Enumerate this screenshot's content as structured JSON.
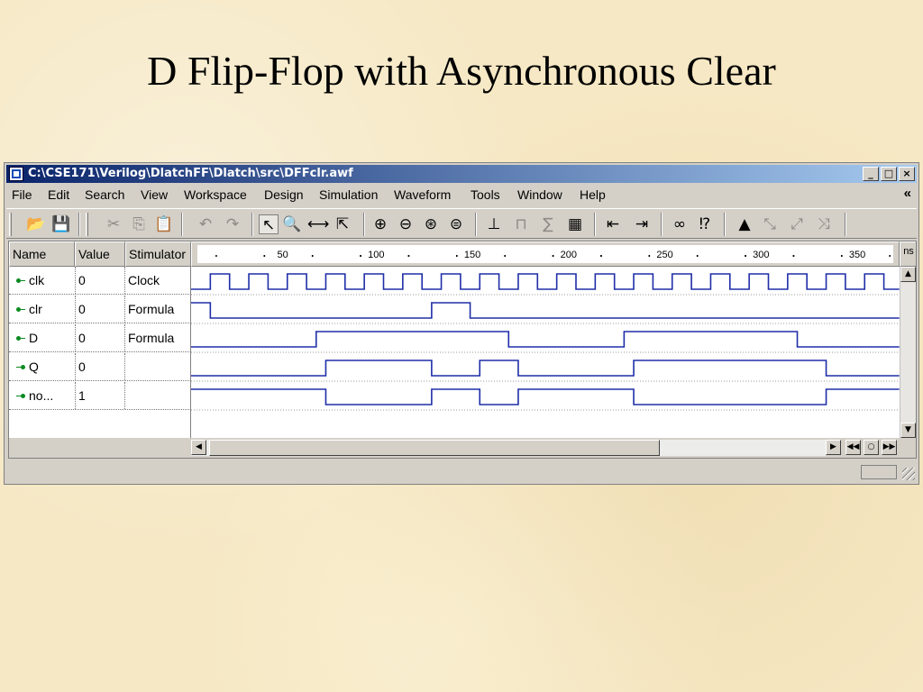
{
  "slide": {
    "title": "D Flip-Flop with Asynchronous Clear"
  },
  "window": {
    "title": "C:\\CSE171\\Verilog\\DlatchFF\\Dlatch\\src\\DFFclr.awf",
    "controls": {
      "minimize": "_",
      "maximize": "□",
      "close": "×"
    }
  },
  "menu": {
    "items": [
      "File",
      "Edit",
      "Search",
      "View",
      "Workspace",
      "Design",
      "Simulation",
      "Waveform",
      "Tools",
      "Window",
      "Help"
    ],
    "overflow": "«"
  },
  "toolbar": {
    "icons": [
      "open-folder",
      "save",
      "cut",
      "copy",
      "paste",
      "undo",
      "redo",
      "select-pointer",
      "zoom",
      "measure",
      "edit-pointer",
      "zoom-in",
      "zoom-out",
      "zoom-fit",
      "zoom-area",
      "add-signal",
      "clock-signal",
      "formula",
      "stimulators",
      "goto-start",
      "goto-end",
      "find",
      "find-next",
      "marker",
      "edge-prev",
      "edge-next",
      "edge-any"
    ]
  },
  "columns": {
    "name": "Name",
    "value": "Value",
    "stimulator": "Stimulator"
  },
  "timeline": {
    "unit": "ns",
    "labels": [
      "50",
      "100",
      "150",
      "200",
      "250",
      "300",
      "350"
    ]
  },
  "signals": [
    {
      "name": "clk",
      "value": "0",
      "stimulator": "Clock",
      "direction": "input"
    },
    {
      "name": "clr",
      "value": "0",
      "stimulator": "Formula",
      "direction": "input"
    },
    {
      "name": "D",
      "value": "0",
      "stimulator": "Formula",
      "direction": "input"
    },
    {
      "name": "Q",
      "value": "0",
      "stimulator": "",
      "direction": "output"
    },
    {
      "name": "no...",
      "value": "1",
      "stimulator": "",
      "direction": "output"
    }
  ],
  "colors": {
    "wave": "#1f2ea8",
    "title_bar": "#0a246a",
    "pin": "#0a8a20"
  }
}
